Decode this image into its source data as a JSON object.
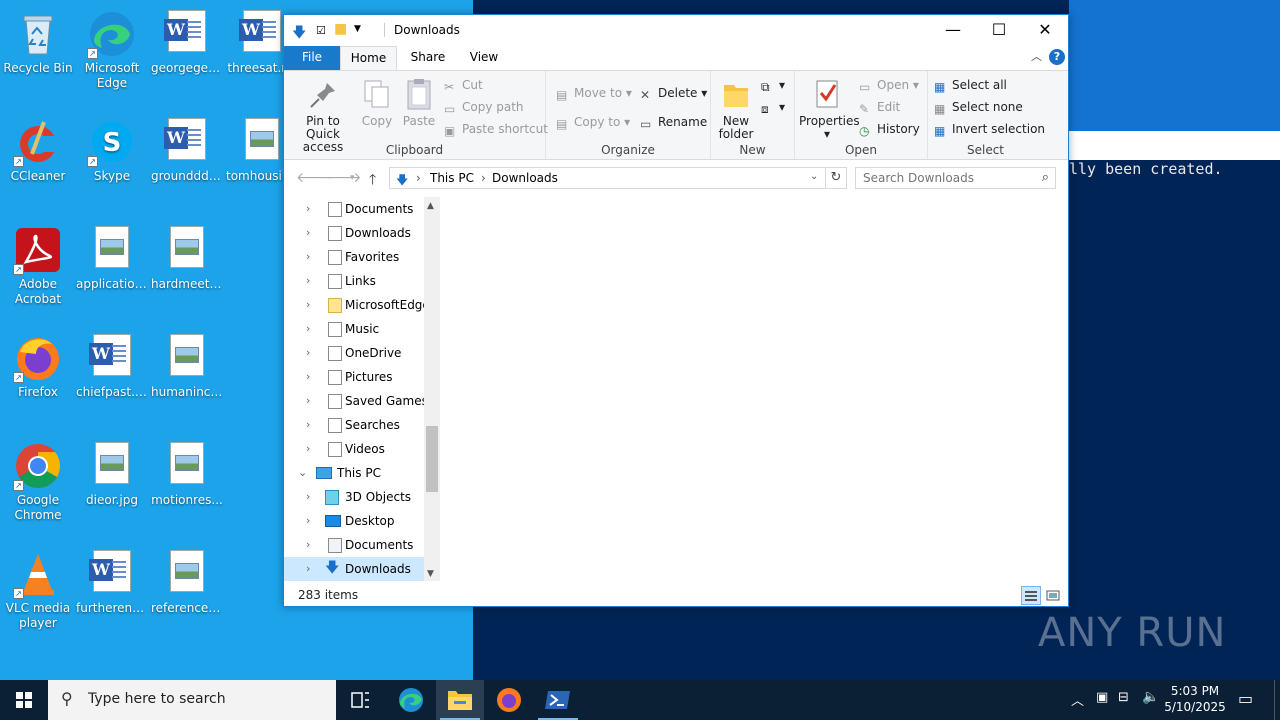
{
  "desktop": {
    "icons": [
      {
        "label": "Recycle Bin"
      },
      {
        "label": "Microsoft Edge"
      },
      {
        "label": "georgegett..."
      },
      {
        "label": "threesat.r..."
      },
      {
        "label": "CCleaner"
      },
      {
        "label": "Skype"
      },
      {
        "label": "groundddo..."
      },
      {
        "label": "tomhousin..."
      },
      {
        "label": "Adobe Acrobat"
      },
      {
        "label": "application..."
      },
      {
        "label": "hardmeetin..."
      },
      {
        "label": "Firefox"
      },
      {
        "label": "chiefpast.rtf"
      },
      {
        "label": "humanincl..."
      },
      {
        "label": "Google Chrome"
      },
      {
        "label": "dieor.jpg"
      },
      {
        "label": "motionres..."
      },
      {
        "label": "VLC media player"
      },
      {
        "label": "furtherenvi..."
      },
      {
        "label": "referencesh..."
      }
    ],
    "console_text": "lly been created.",
    "watermark": "ANY RUN"
  },
  "explorer": {
    "title": "Downloads",
    "tabs": {
      "file": "File",
      "home": "Home",
      "share": "Share",
      "view": "View"
    },
    "ribbon": {
      "clipboard": {
        "label": "Clipboard",
        "pin": "Pin to Quick access",
        "copy": "Copy",
        "paste": "Paste",
        "cut": "Cut",
        "copy_path": "Copy path",
        "paste_shortcut": "Paste shortcut"
      },
      "organize": {
        "label": "Organize",
        "move_to": "Move to",
        "copy_to": "Copy to",
        "delete": "Delete",
        "rename": "Rename"
      },
      "new": {
        "label": "New",
        "new_folder": "New folder"
      },
      "open": {
        "label": "Open",
        "properties": "Properties",
        "open": "Open",
        "edit": "Edit",
        "history": "History"
      },
      "select": {
        "label": "Select",
        "select_all": "Select all",
        "select_none": "Select none",
        "invert": "Invert selection"
      }
    },
    "address": {
      "crumb1": "This PC",
      "crumb2": "Downloads"
    },
    "search_placeholder": "Search Downloads",
    "tree": [
      {
        "label": "Documents",
        "level": 1
      },
      {
        "label": "Downloads",
        "level": 1
      },
      {
        "label": "Favorites",
        "level": 1
      },
      {
        "label": "Links",
        "level": 1
      },
      {
        "label": "MicrosoftEdge",
        "level": 1
      },
      {
        "label": "Music",
        "level": 1
      },
      {
        "label": "OneDrive",
        "level": 1
      },
      {
        "label": "Pictures",
        "level": 1
      },
      {
        "label": "Saved Games",
        "level": 1
      },
      {
        "label": "Searches",
        "level": 1
      },
      {
        "label": "Videos",
        "level": 1
      },
      {
        "label": "This PC",
        "level": 0
      },
      {
        "label": "3D Objects",
        "level": 1
      },
      {
        "label": "Desktop",
        "level": 1
      },
      {
        "label": "Documents",
        "level": 1
      },
      {
        "label": "Downloads",
        "level": 1
      }
    ],
    "status": "283 items"
  },
  "taskbar": {
    "search_placeholder": "Type here to search",
    "time": "5:03 PM",
    "date": "5/10/2025"
  },
  "colors": {
    "desktop": "#1ca3ea",
    "console": "#012456",
    "accent": "#1979ca",
    "taskbar": "#0b1f35"
  }
}
